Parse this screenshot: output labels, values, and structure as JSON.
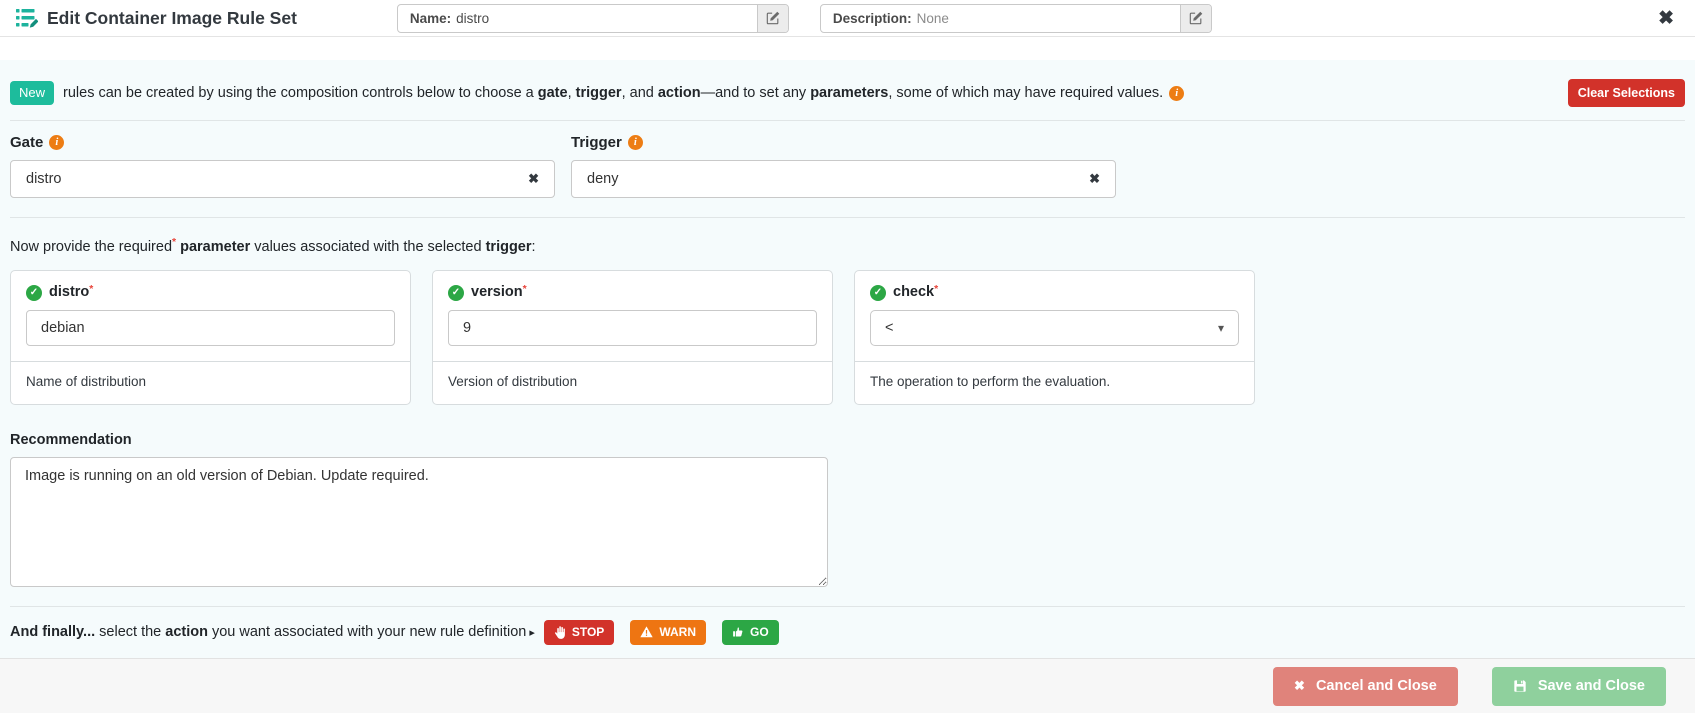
{
  "header": {
    "title": "Edit Container Image Rule Set",
    "name_field": {
      "label": "Name:",
      "value": "distro"
    },
    "description_field": {
      "label": "Description:",
      "value": "None"
    }
  },
  "icons": {
    "close": "✖",
    "clear": "✖",
    "cancel": "✖",
    "info": "i",
    "check": "✓",
    "chevron_down": "▾",
    "caret_right": "▸"
  },
  "banner": {
    "badge": "New",
    "text": [
      {
        "t": "rules can be created by using the composition controls below to choose a "
      },
      {
        "t": "gate",
        "b": true
      },
      {
        "t": ", "
      },
      {
        "t": "trigger",
        "b": true
      },
      {
        "t": ", and "
      },
      {
        "t": "action",
        "b": true
      },
      {
        "t": "—and to set any "
      },
      {
        "t": "parameters",
        "b": true
      },
      {
        "t": ", some of which may have required values."
      }
    ],
    "clear_button": "Clear Selections"
  },
  "composition": {
    "gate": {
      "label": "Gate",
      "value": "distro"
    },
    "trigger": {
      "label": "Trigger",
      "value": "deny"
    }
  },
  "parameters": {
    "intro": [
      {
        "t": "Now provide the required"
      },
      {
        "t": "*",
        "sup": true
      },
      {
        "t": " "
      },
      {
        "t": "parameter",
        "b": true
      },
      {
        "t": " values associated with the selected "
      },
      {
        "t": "trigger",
        "b": true
      },
      {
        "t": ":"
      }
    ],
    "cards": [
      {
        "label": "distro",
        "required": "*",
        "value": "debian",
        "description": "Name of distribution"
      },
      {
        "label": "version",
        "required": "*",
        "value": "9",
        "description": "Version of distribution"
      },
      {
        "label": "check",
        "required": "*",
        "value": "<",
        "description": "The operation to perform the evaluation."
      }
    ]
  },
  "recommendation": {
    "label": "Recommendation",
    "value": "Image is running on an old version of Debian. Update required."
  },
  "actions": {
    "intro": [
      {
        "t": "And finally... ",
        "b": true
      },
      {
        "t": "select the "
      },
      {
        "t": "action",
        "b": true
      },
      {
        "t": " you want associated with your new rule definition"
      }
    ],
    "stop": "STOP",
    "warn": "WARN",
    "go": "GO"
  },
  "footer": {
    "cancel": "Cancel and Close",
    "save": "Save and Close"
  },
  "colors": {
    "badge_teal": "#1dbc9c",
    "danger_red": "#d2322a",
    "warn_orange": "#ee7512",
    "go_green": "#2ca745",
    "info_orange": "#ed7d14",
    "check_green": "#2ca745",
    "cancel_salmon": "#e0837b",
    "save_green": "#8fd09d",
    "panel_azure": "#f5fbfc"
  }
}
